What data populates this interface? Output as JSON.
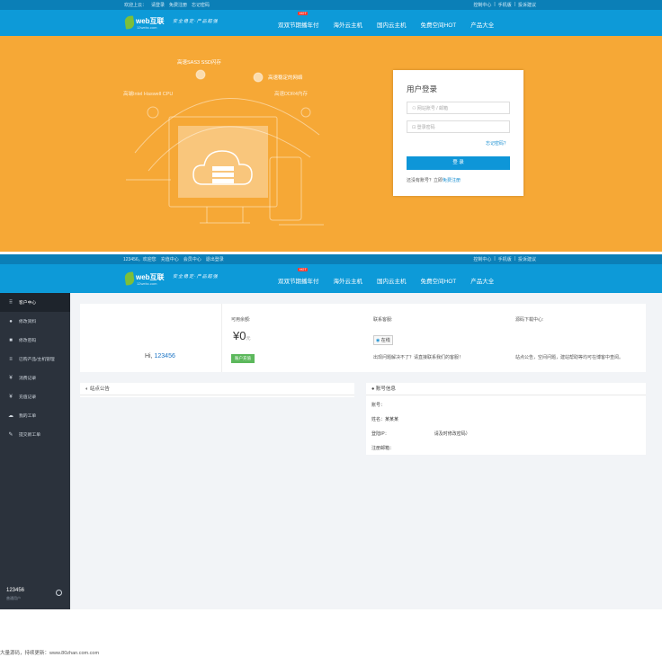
{
  "topbar": {
    "welcome": "欢迎上云：",
    "links_left": [
      "请登录",
      "免费注册",
      "忘记密码"
    ],
    "links_right": [
      "控制中心",
      "|",
      "手机版",
      "|",
      "投诉建议"
    ]
  },
  "brand": {
    "logo_main": "web互联",
    "logo_sub": "12webc.com",
    "slogan": "安全稳定·产品超强"
  },
  "nav": {
    "items": [
      "双双节期播年付",
      "海外云主机",
      "国内云主机",
      "免费空间HOT",
      "产品大全"
    ],
    "hot_badge": "HOT"
  },
  "banner": {
    "features": [
      "高速SAS3 SSD闪存",
      "高端Intel Haswell CPU",
      "高速稳定的网络",
      "高速DDR4内存"
    ]
  },
  "login": {
    "title": "用户登录",
    "username_placeholder": "网站账号 / 邮箱",
    "password_placeholder": "登录密码",
    "forgot": "忘记密码？",
    "submit": "登 录",
    "register_prompt": "还没有账号？立即",
    "register_link": "免费注册"
  },
  "topbar2": {
    "user_links": [
      "123456，欢迎您",
      "充值中心",
      "会员中心",
      "退出登录"
    ],
    "links_right": [
      "控制中心",
      "|",
      "手机版",
      "|",
      "投诉建议"
    ]
  },
  "nav2": {
    "items": [
      "双双节期播年付",
      "海外云主机",
      "国内云主机",
      "免费空间HOT",
      "产品大全"
    ],
    "hot_badge": "HOT"
  },
  "sidebar": {
    "items": [
      {
        "label": "客户中心",
        "icon": "grid-icon"
      },
      {
        "label": "修改资料",
        "icon": "user-icon"
      },
      {
        "label": "修改密码",
        "icon": "lock-icon"
      },
      {
        "label": "已购产品/主机管理",
        "icon": "list-icon"
      },
      {
        "label": "消费记录",
        "icon": "yen-icon"
      },
      {
        "label": "充值记录",
        "icon": "yen-circle-icon"
      },
      {
        "label": "我的工单",
        "icon": "cloud-icon"
      },
      {
        "label": "提交新工单",
        "icon": "pencil-icon"
      }
    ],
    "username": "123456",
    "role": "普通用户"
  },
  "dashboard": {
    "greeting": "Hi, ",
    "user_id": "123456",
    "balance_label": "可用余额:",
    "balance_symbol": "¥",
    "balance_value": "0",
    "balance_unit": "元",
    "recharge_button": "账户充值",
    "service_label": "联系客服:",
    "service_text": "出现问题解决不了？请直接联系我们的客服！",
    "qq_label": "在线",
    "source_label": "源码下载中心:",
    "source_text": "站点公告，空间问题，建站帮助等均可在博客中查阅。"
  },
  "notice": {
    "title": "站点公告"
  },
  "account": {
    "title": "账号信息",
    "rows": [
      "账号：",
      "姓名：某某某",
      "登陆IP：",
      "注册邮箱："
    ],
    "ip_note": "请及时修改密码）"
  },
  "footer": {
    "text": "大量源码，持续更新：www.80zhan.com.com"
  }
}
